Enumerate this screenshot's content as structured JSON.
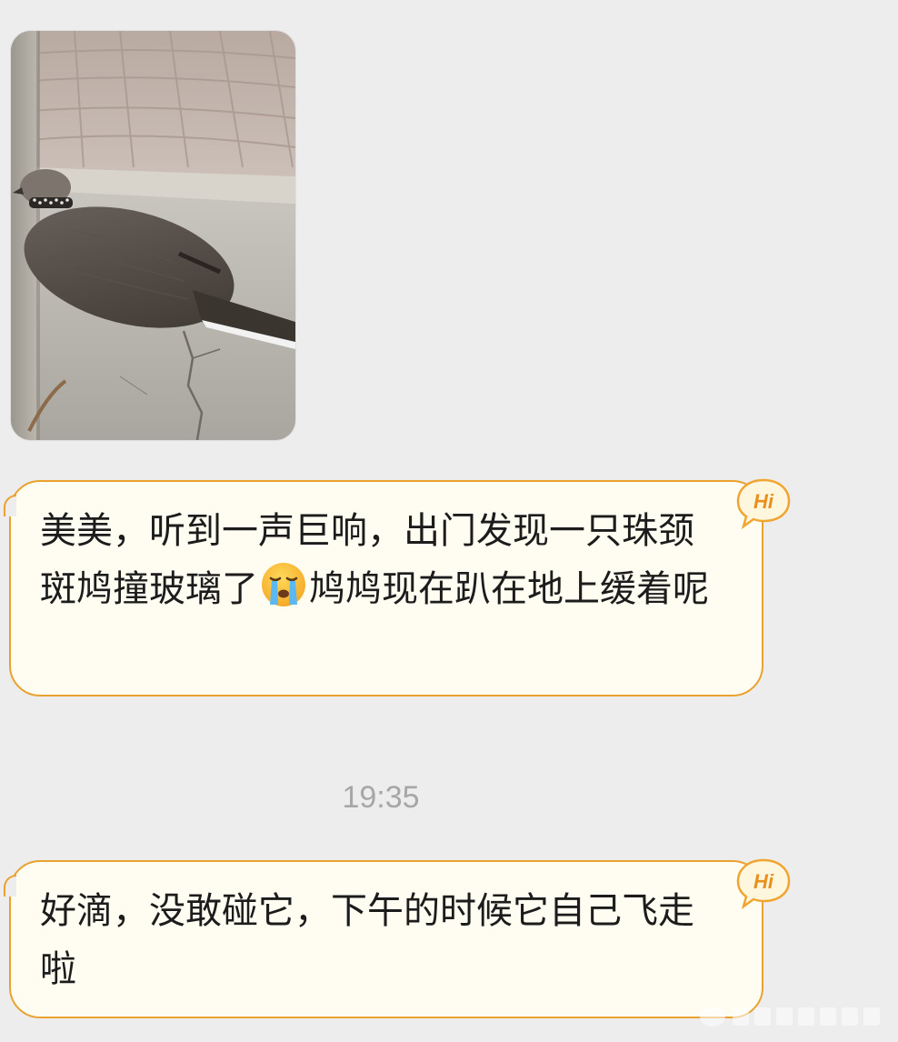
{
  "messages": [
    {
      "type": "image",
      "alt": "spotted dove lying on concrete"
    },
    {
      "type": "text",
      "before_emoji": "美美，听到一声巨响，出门发现一只珠颈斑鸠撞玻璃了",
      "emoji": "loudly-crying-face",
      "after_emoji": "鸠鸠现在趴在地上缓着呢",
      "badge": "Hi"
    },
    {
      "type": "text",
      "text": "好滴，没敢碰它，下午的时候它自己飞走啦",
      "badge": "Hi"
    }
  ],
  "timestamp": "19:35",
  "colors": {
    "background": "#ededed",
    "bubble_fill": "#fffdf2",
    "bubble_border": "#e9a22f",
    "badge": "#f0a531",
    "timestamp": "#a7a7a7"
  }
}
